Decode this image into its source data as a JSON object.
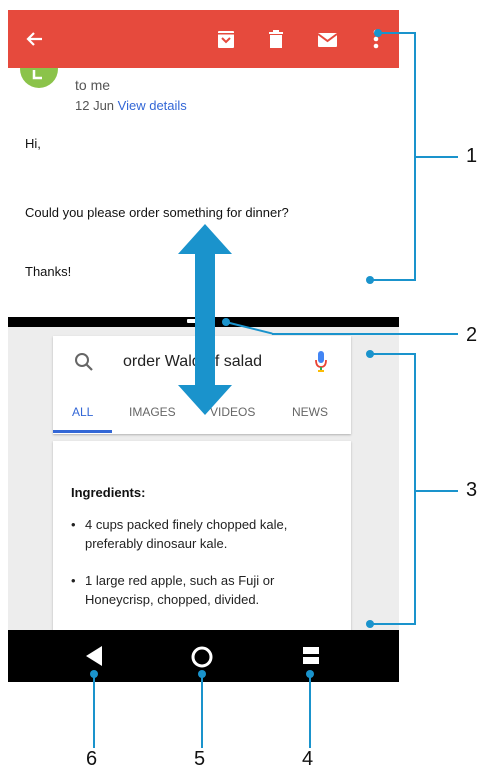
{
  "email": {
    "to_line": "to me",
    "date": "12 Jun",
    "details_link": "View details",
    "greeting": "Hi,",
    "message": "Could you please order something for dinner?",
    "signoff": "Thanks!",
    "toolbar_icons": [
      "back-arrow-icon",
      "archive-icon",
      "delete-icon",
      "mail-icon",
      "more-vert-icon"
    ]
  },
  "search": {
    "query": "order Waldorf salad",
    "tabs": [
      "ALL",
      "IMAGES",
      "VIDEOS",
      "NEWS"
    ],
    "active_tab": "ALL"
  },
  "result": {
    "heading": "Ingredients:",
    "items": [
      "4 cups packed finely chopped kale, preferably dinosaur kale.",
      "1 large red apple, such as Fuji or Honeycrisp, chopped, divided."
    ]
  },
  "callouts": [
    "1",
    "2",
    "3",
    "4",
    "5",
    "6"
  ],
  "colors": {
    "toolbar": "#e64a3d",
    "accent": "#3367d6",
    "callout_line": "#1a93cc",
    "avatar": "#8bc34a"
  }
}
